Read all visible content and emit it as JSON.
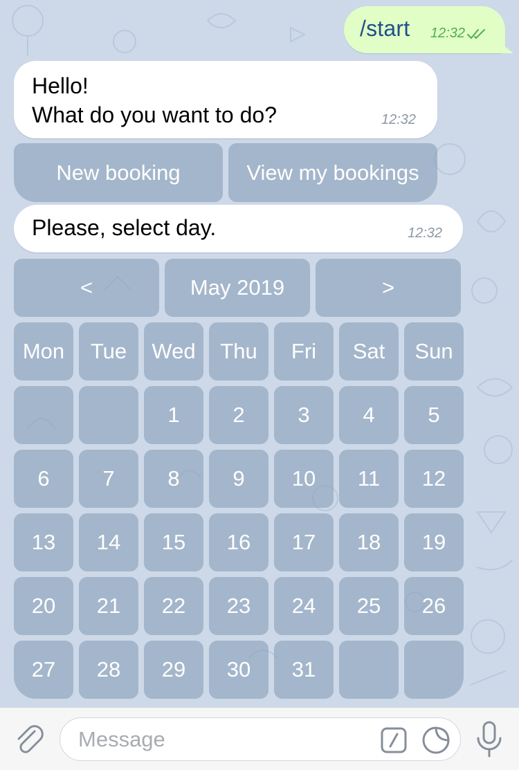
{
  "messages": {
    "outgoing": {
      "text": "/start",
      "time": "12:32"
    },
    "greeting": {
      "line1": "Hello!",
      "line2": "What do you want to do?",
      "time": "12:32"
    },
    "select_day": {
      "text": "Please, select day.",
      "time": "12:32"
    }
  },
  "menu_keyboard": {
    "new_booking": "New booking",
    "view_bookings": "View my bookings"
  },
  "calendar": {
    "prev": "<",
    "month": "May 2019",
    "next": ">",
    "weekdays": [
      "Mon",
      "Tue",
      "Wed",
      "Thu",
      "Fri",
      "Sat",
      "Sun"
    ],
    "weeks": [
      [
        "",
        "",
        "1",
        "2",
        "3",
        "4",
        "5"
      ],
      [
        "6",
        "7",
        "8",
        "9",
        "10",
        "11",
        "12"
      ],
      [
        "13",
        "14",
        "15",
        "16",
        "17",
        "18",
        "19"
      ],
      [
        "20",
        "21",
        "22",
        "23",
        "24",
        "25",
        "26"
      ],
      [
        "27",
        "28",
        "29",
        "30",
        "31",
        "",
        ""
      ]
    ]
  },
  "input_bar": {
    "placeholder": "Message"
  },
  "icons": {
    "attach": "paperclip-icon",
    "commands": "slash-command-icon",
    "stickers": "sticker-icon",
    "voice": "microphone-icon"
  },
  "colors": {
    "outgoing_bubble": "#e1fec6",
    "incoming_bubble": "#ffffff",
    "chat_background": "#cdd9e8",
    "keyboard_button": "#8aa0b9",
    "read_checks": "#4fae4e"
  }
}
